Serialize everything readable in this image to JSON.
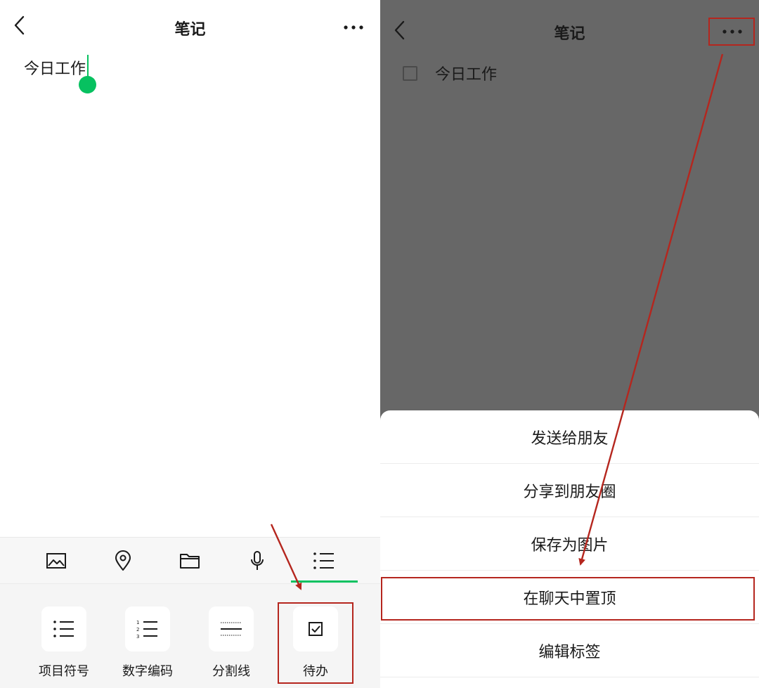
{
  "left": {
    "nav": {
      "title": "笔记"
    },
    "note_text": "今日工作",
    "toolbar": [
      "image-icon",
      "location-icon",
      "folder-icon",
      "microphone-icon",
      "list-format-icon"
    ],
    "format_options": [
      {
        "label": "项目符号",
        "icon": "bullet-list-icon"
      },
      {
        "label": "数字编码",
        "icon": "numbered-list-icon"
      },
      {
        "label": "分割线",
        "icon": "divider-icon"
      },
      {
        "label": "待办",
        "icon": "checkbox-icon"
      }
    ]
  },
  "right": {
    "nav": {
      "title": "笔记"
    },
    "todo_item": "今日工作",
    "sheet": {
      "items": [
        "发送给朋友",
        "分享到朋友圈",
        "保存为图片",
        "在聊天中置顶",
        "编辑标签"
      ]
    }
  },
  "colors": {
    "accent_green": "#07c160",
    "annotation_red": "#b5261e",
    "overlay": "#676767"
  }
}
